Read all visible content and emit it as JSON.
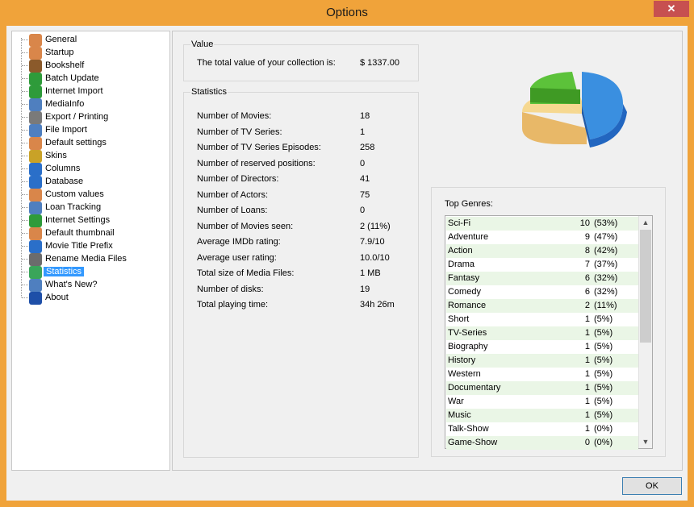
{
  "window": {
    "title": "Options",
    "close_label": "✕"
  },
  "tree": {
    "items": [
      {
        "label": "General",
        "icon": "person-icon",
        "color": "#d9864a"
      },
      {
        "label": "Startup",
        "icon": "person-icon",
        "color": "#d9864a"
      },
      {
        "label": "Bookshelf",
        "icon": "bookshelf-icon",
        "color": "#8b5a2b"
      },
      {
        "label": "Batch Update",
        "icon": "globe-icon",
        "color": "#2e9b3a"
      },
      {
        "label": "Internet Import",
        "icon": "globe-icon",
        "color": "#2e9b3a"
      },
      {
        "label": "MediaInfo",
        "icon": "gear-icon",
        "color": "#4f7fbf"
      },
      {
        "label": "Export / Printing",
        "icon": "printer-icon",
        "color": "#7a7a7a"
      },
      {
        "label": "File Import",
        "icon": "file-icon",
        "color": "#4f7fbf"
      },
      {
        "label": "Default settings",
        "icon": "person-icon",
        "color": "#d9864a"
      },
      {
        "label": "Skins",
        "icon": "skins-icon",
        "color": "#c9a227"
      },
      {
        "label": "Columns",
        "icon": "windows-icon",
        "color": "#2a6fc9"
      },
      {
        "label": "Database",
        "icon": "windows-icon",
        "color": "#2a6fc9"
      },
      {
        "label": "Custom values",
        "icon": "person-icon",
        "color": "#d9864a"
      },
      {
        "label": "Loan Tracking",
        "icon": "gear-icon",
        "color": "#4f7fbf"
      },
      {
        "label": "Internet Settings",
        "icon": "globe-icon",
        "color": "#2e9b3a"
      },
      {
        "label": "Default thumbnail",
        "icon": "person-icon",
        "color": "#d9864a"
      },
      {
        "label": "Movie Title Prefix",
        "icon": "windows-icon",
        "color": "#2a6fc9"
      },
      {
        "label": "Rename Media Files",
        "icon": "file-icon",
        "color": "#6c6c6c"
      },
      {
        "label": "Statistics",
        "icon": "pie-chart-icon",
        "color": "#3aa55a",
        "selected": true
      },
      {
        "label": "What's New?",
        "icon": "gear-icon",
        "color": "#4f7fbf"
      },
      {
        "label": "About",
        "icon": "info-icon",
        "color": "#1e4fa8"
      }
    ]
  },
  "value_group": {
    "title": "Value",
    "label": "The total value of your collection is:",
    "amount": "$ 1337.00"
  },
  "stats_group": {
    "title": "Statistics",
    "rows": [
      {
        "label": "Number of Movies:",
        "value": "18"
      },
      {
        "label": "Number of TV Series:",
        "value": "1"
      },
      {
        "label": "Number of TV Series Episodes:",
        "value": "258"
      },
      {
        "label": "Number of reserved positions:",
        "value": "0"
      },
      {
        "label": "Number of Directors:",
        "value": "41"
      },
      {
        "label": "Number of Actors:",
        "value": "75"
      },
      {
        "label": "Number of Loans:",
        "value": "0"
      },
      {
        "label": "Number of Movies seen:",
        "value": "2  (11%)"
      },
      {
        "label": "Average IMDb rating:",
        "value": "7.9/10"
      },
      {
        "label": "Average user rating:",
        "value": "10.0/10"
      },
      {
        "label": "Total size of Media Files:",
        "value": "1 MB"
      },
      {
        "label": "Number of disks:",
        "value": "19"
      },
      {
        "label": "Total playing time:",
        "value": "34h 26m"
      }
    ]
  },
  "genres": {
    "title": "Top Genres:",
    "items": [
      {
        "name": "Sci-Fi",
        "count": "10",
        "pct": "(53%)"
      },
      {
        "name": "Adventure",
        "count": "9",
        "pct": "(47%)"
      },
      {
        "name": "Action",
        "count": "8",
        "pct": "(42%)"
      },
      {
        "name": "Drama",
        "count": "7",
        "pct": "(37%)"
      },
      {
        "name": "Fantasy",
        "count": "6",
        "pct": "(32%)"
      },
      {
        "name": "Comedy",
        "count": "6",
        "pct": "(32%)"
      },
      {
        "name": "Romance",
        "count": "2",
        "pct": "(11%)"
      },
      {
        "name": "Short",
        "count": "1",
        "pct": "(5%)"
      },
      {
        "name": "TV-Series",
        "count": "1",
        "pct": "(5%)"
      },
      {
        "name": "Biography",
        "count": "1",
        "pct": "(5%)"
      },
      {
        "name": "History",
        "count": "1",
        "pct": "(5%)"
      },
      {
        "name": "Western",
        "count": "1",
        "pct": "(5%)"
      },
      {
        "name": "Documentary",
        "count": "1",
        "pct": "(5%)"
      },
      {
        "name": "War",
        "count": "1",
        "pct": "(5%)"
      },
      {
        "name": "Music",
        "count": "1",
        "pct": "(5%)"
      },
      {
        "name": "Talk-Show",
        "count": "1",
        "pct": "(0%)"
      },
      {
        "name": "Game-Show",
        "count": "0",
        "pct": "(0%)"
      }
    ]
  },
  "pie_icon": {
    "colors": [
      "#3a8fe0",
      "#5cc23a",
      "#f0c870"
    ]
  },
  "ok_label": "OK"
}
